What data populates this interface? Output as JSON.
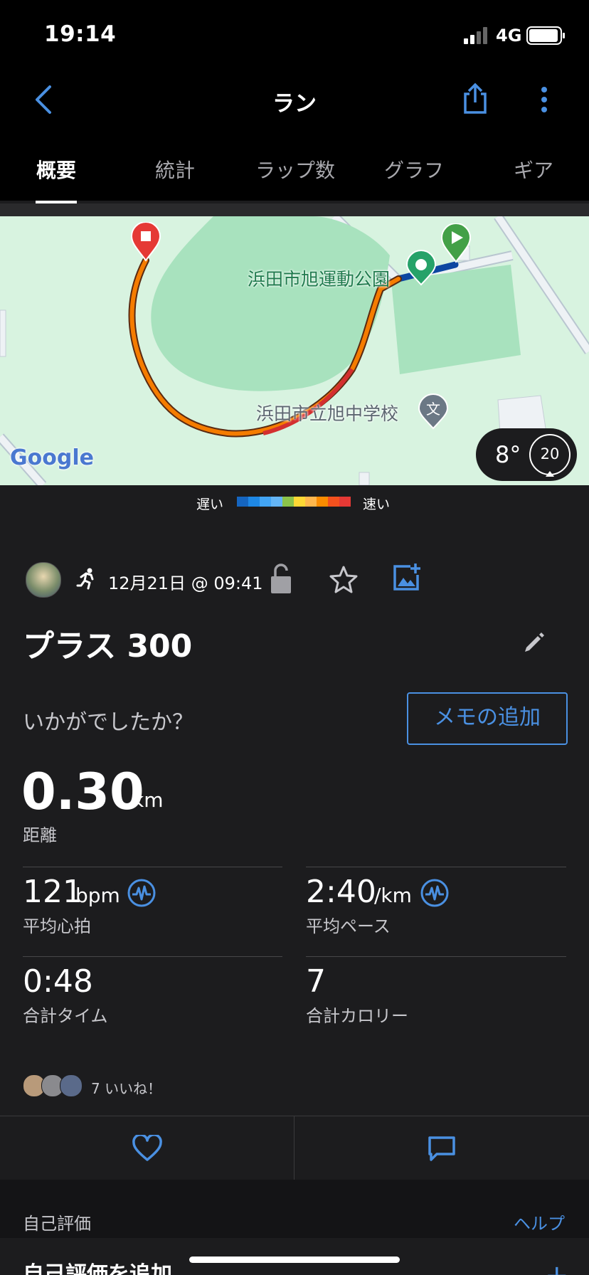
{
  "status": {
    "time": "19:14",
    "network": "4G"
  },
  "nav": {
    "title": "ラン"
  },
  "tabs": [
    "概要",
    "統計",
    "ラップ数",
    "グラフ",
    "ギア"
  ],
  "map": {
    "poi_park": "浜田市旭運動公園",
    "poi_school": "浜田市立旭中学校",
    "attribution": "Google",
    "weather_temp": "8°",
    "wind_speed": "20"
  },
  "pace_legend": {
    "slow": "遅い",
    "fast": "速い",
    "colors": [
      "#1565c0",
      "#1e88e5",
      "#42a5f5",
      "#64b5f6",
      "#8bc34a",
      "#fdd835",
      "#ffb74d",
      "#fb8c00",
      "#f4511e",
      "#e53935"
    ]
  },
  "activity": {
    "date_time": "12月21日 @ 09:41",
    "name": "プラス 300",
    "feeling_prompt": "いかがでしたか？",
    "add_note_label": "メモの追加"
  },
  "stats": {
    "distance_value": "0.30",
    "distance_unit": "km",
    "distance_label": "距離",
    "hr_value": "121",
    "hr_unit": "bpm",
    "hr_label": "平均心拍",
    "pace_value": "2:40",
    "pace_unit": "/km",
    "pace_label": "平均ペース",
    "time_value": "0:48",
    "time_label": "合計タイム",
    "calories_value": "7",
    "calories_label": "合計カロリー"
  },
  "social": {
    "likes_text": "7 いいね！"
  },
  "self_eval": {
    "section_label": "自己評価",
    "help_link": "ヘルプ",
    "add_label": "自己評価を追加"
  },
  "colors": {
    "accent": "#4a90e2",
    "background": "#1c1c1e"
  }
}
